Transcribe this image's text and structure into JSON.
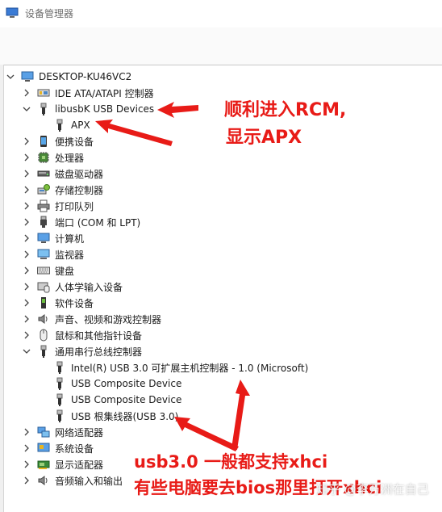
{
  "window": {
    "title": "设备管理器"
  },
  "tree": {
    "root": "DESKTOP-KU46VC2",
    "items": [
      {
        "label": "IDE ATA/ATAPI 控制器",
        "icon": "ide-controller-icon"
      },
      {
        "label": "libusbK USB Devices",
        "icon": "usb-plug-icon"
      },
      {
        "label": "APX",
        "icon": "usb-plug-icon"
      },
      {
        "label": "便携设备",
        "icon": "portable-device-icon"
      },
      {
        "label": "处理器",
        "icon": "processor-icon"
      },
      {
        "label": "磁盘驱动器",
        "icon": "disk-drive-icon"
      },
      {
        "label": "存储控制器",
        "icon": "storage-controller-icon"
      },
      {
        "label": "打印队列",
        "icon": "printer-icon"
      },
      {
        "label": "端口 (COM 和 LPT)",
        "icon": "port-icon"
      },
      {
        "label": "计算机",
        "icon": "computer-icon"
      },
      {
        "label": "监视器",
        "icon": "monitor-icon"
      },
      {
        "label": "键盘",
        "icon": "keyboard-icon"
      },
      {
        "label": "人体学输入设备",
        "icon": "hid-icon"
      },
      {
        "label": "软件设备",
        "icon": "software-device-icon"
      },
      {
        "label": "声音、视频和游戏控制器",
        "icon": "speaker-icon"
      },
      {
        "label": "鼠标和其他指针设备",
        "icon": "mouse-icon"
      },
      {
        "label": "通用串行总线控制器",
        "icon": "usb-plug-icon"
      },
      {
        "label": "Intel(R) USB 3.0 可扩展主机控制器 - 1.0 (Microsoft)",
        "icon": "usb-plug-icon"
      },
      {
        "label": "USB Composite Device",
        "icon": "usb-plug-icon"
      },
      {
        "label": "USB Composite Device",
        "icon": "usb-plug-icon"
      },
      {
        "label": "USB 根集线器(USB 3.0)",
        "icon": "usb-plug-icon"
      },
      {
        "label": "网络适配器",
        "icon": "network-adapter-icon"
      },
      {
        "label": "系统设备",
        "icon": "system-device-icon"
      },
      {
        "label": "显示适配器",
        "icon": "display-adapter-icon"
      },
      {
        "label": "音频输入和输出",
        "icon": "speaker-icon"
      }
    ]
  },
  "annotations": {
    "line1": "顺利进入RCM,",
    "line2": "显示APX",
    "line3": "usb3.0 一般都支持xhci",
    "line4": "有些电脑要去bios那里打开xhci"
  },
  "watermark": "知乎 @李万洲在自己",
  "colors": {
    "annotation": "#e81b17",
    "arrow": "#e81b17"
  }
}
